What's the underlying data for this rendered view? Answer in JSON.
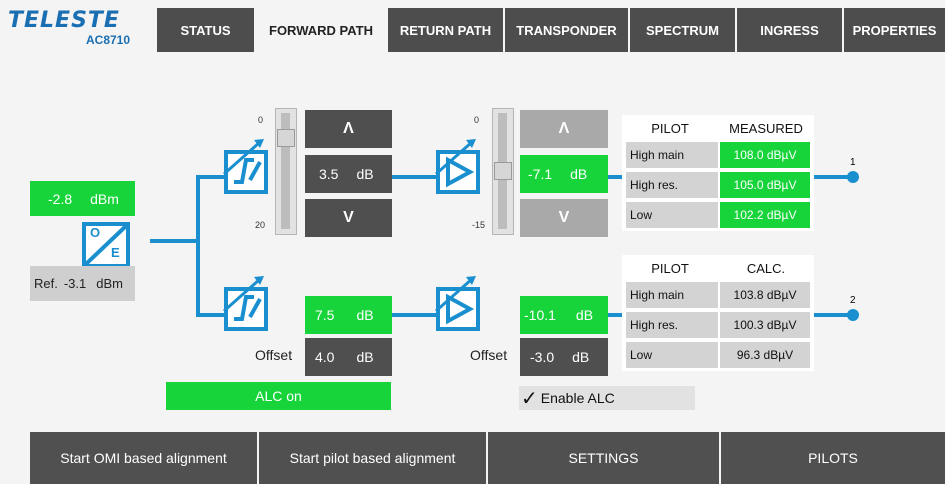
{
  "brand": {
    "name": "TELESTE",
    "model": "AC8710"
  },
  "tabs": [
    {
      "label": "STATUS"
    },
    {
      "label": "FORWARD PATH"
    },
    {
      "label": "RETURN PATH"
    },
    {
      "label": "TRANSPONDER"
    },
    {
      "label": "SPECTRUM"
    },
    {
      "label": "INGRESS"
    },
    {
      "label": "PROPERTIES"
    }
  ],
  "active_tab": "FORWARD PATH",
  "input": {
    "level_value": "-2.8",
    "level_unit": "dBm",
    "ref_label": "Ref.",
    "ref_value": "-3.1",
    "ref_unit": "dBm",
    "oe_o": "O",
    "oe_e": "E"
  },
  "upper": {
    "slider1_top": "0",
    "slider1_bottom": "20",
    "att_value": "3.5",
    "att_unit": "dB",
    "slider2_top": "0",
    "slider2_bottom": "-15",
    "amp_value": "-7.1",
    "amp_unit": "dB",
    "up_symbol": "Λ",
    "down_symbol": "V"
  },
  "lower": {
    "eq_value": "7.5",
    "eq_unit": "dB",
    "offset1_label": "Offset",
    "offset1_value": "4.0",
    "offset1_unit": "dB",
    "amp_value": "-10.1",
    "amp_unit": "dB",
    "offset2_label": "Offset",
    "offset2_value": "-3.0",
    "offset2_unit": "dB"
  },
  "alc": {
    "status": "ALC on",
    "enable_label": "Enable ALC",
    "enabled": true
  },
  "table_measured": {
    "headers": [
      "PILOT",
      "MEASURED"
    ],
    "rows": [
      {
        "label": "High main",
        "value": "108.0 dBµV"
      },
      {
        "label": "High res.",
        "value": "105.0 dBµV"
      },
      {
        "label": "Low",
        "value": "102.2 dBµV"
      }
    ],
    "port": "1"
  },
  "table_calc": {
    "headers": [
      "PILOT",
      "CALC."
    ],
    "rows": [
      {
        "label": "High main",
        "value": "103.8 dBµV"
      },
      {
        "label": "High res.",
        "value": "100.3 dBµV"
      },
      {
        "label": "Low",
        "value": "96.3 dBµV"
      }
    ],
    "port": "2"
  },
  "bottom_buttons": [
    {
      "label": "Start OMI based alignment"
    },
    {
      "label": "Start pilot based alignment"
    },
    {
      "label": "SETTINGS"
    },
    {
      "label": "PILOTS"
    }
  ],
  "colors": {
    "accent_blue": "#1a8fd0",
    "ok_green": "#17d43a",
    "dark": "#4f4f4f"
  }
}
